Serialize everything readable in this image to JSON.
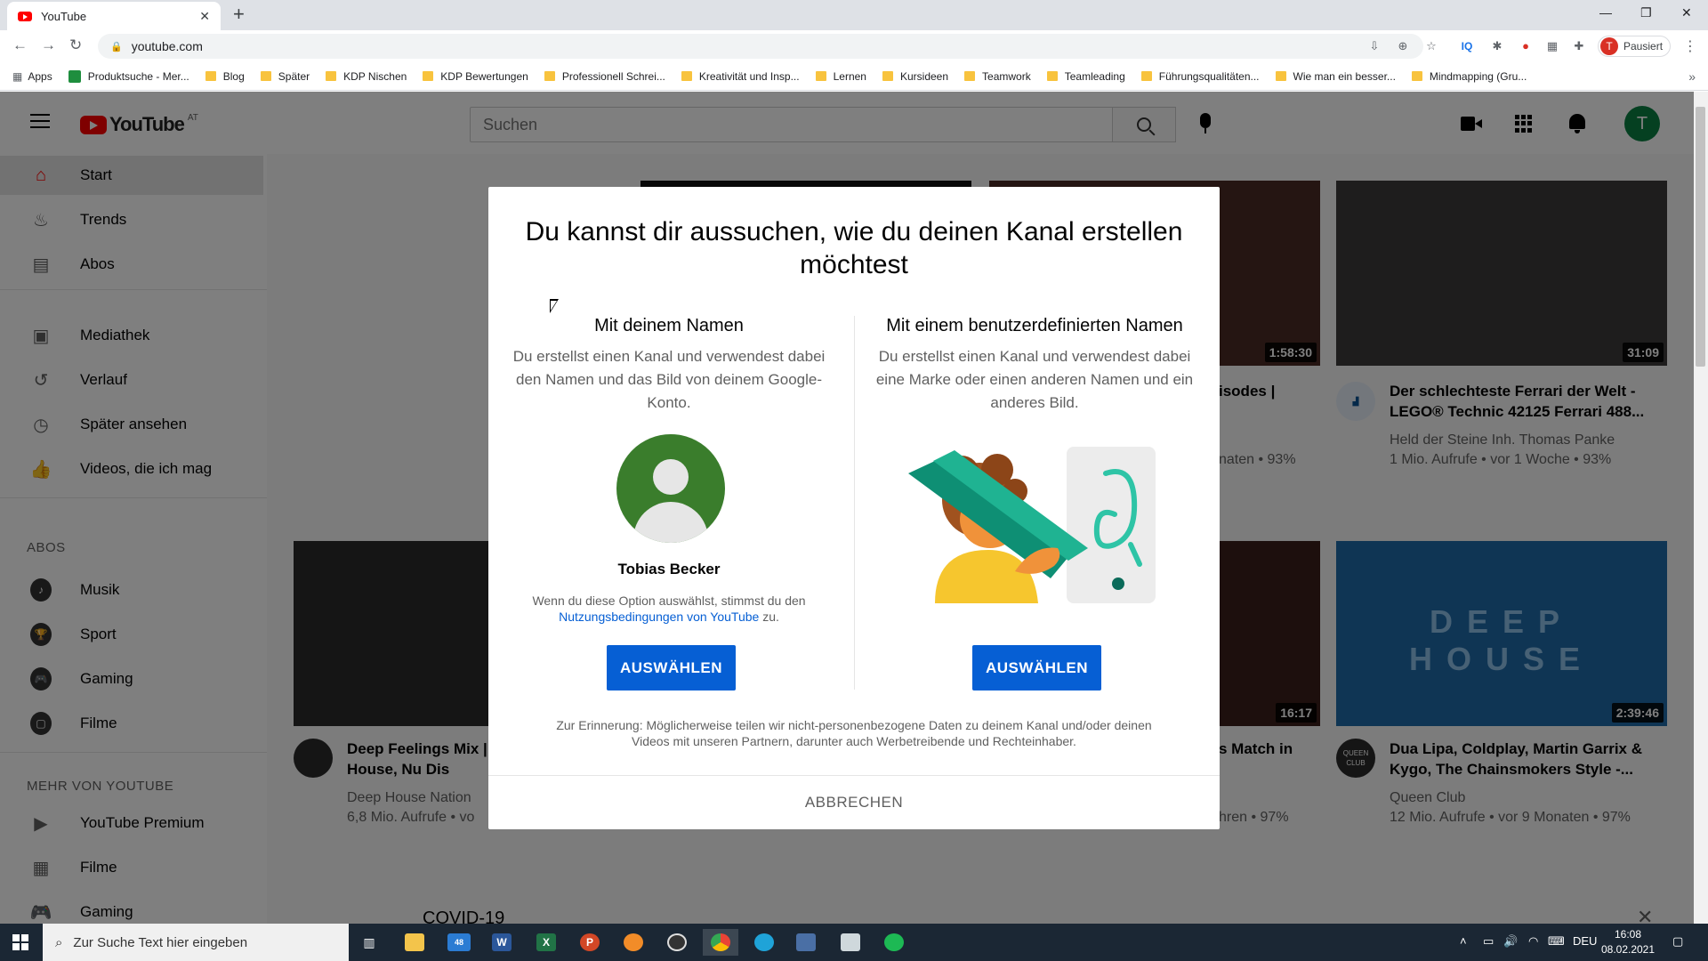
{
  "browser": {
    "tab_title": "YouTube",
    "tab_close": "✕",
    "new_tab": "+",
    "url": "youtube.com",
    "profile_initial": "T",
    "profile_status": "Pausiert",
    "bookmarks": [
      "Apps",
      "Produktsuche - Mer...",
      "Blog",
      "Später",
      "KDP Nischen",
      "KDP Bewertungen",
      "Professionell Schrei...",
      "Kreativität und Insp...",
      "Lernen",
      "Kursideen",
      "Teamwork",
      "Teamleading",
      "Führungsqualitäten...",
      "Wie man ein besser...",
      "Mindmapping (Gru..."
    ]
  },
  "youtube": {
    "logo_text": "YouTube",
    "region": "AT",
    "search_placeholder": "Suchen",
    "avatar_initial": "T",
    "sidebar": {
      "main": [
        "Start",
        "Trends",
        "Abos"
      ],
      "library": [
        "Mediathek",
        "Verlauf",
        "Später ansehen",
        "Videos, die ich mag"
      ],
      "subs_heading": "ABOS",
      "subs": [
        "Musik",
        "Sport",
        "Gaming",
        "Filme"
      ],
      "more_heading": "MEHR VON YOUTUBE",
      "more": [
        "YouTube Premium",
        "Filme",
        "Gaming"
      ]
    },
    "videos": [
      {
        "duration": "1:58:30",
        "title": "isodes |",
        "meta": "naten • 93%"
      },
      {
        "duration": "31:09",
        "title": "Der schlechteste Ferrari der Welt - LEGO® Technic 42125 Ferrari 488...",
        "channel": "Held der Steine Inh. Thomas Panke",
        "meta": "1 Mio. Aufrufe • vor 1 Woche • 93%"
      },
      {
        "title": "Deep Feelings Mix | Vocal House, Nu Dis",
        "channel": "Deep House Nation",
        "meta": "6,8 Mio. Aufrufe • vo"
      },
      {
        "duration": "16:17",
        "title": "s Match in",
        "meta": "hren • 97%"
      },
      {
        "duration": "2:39:46",
        "title": "Dua Lipa, Coldplay, Martin Garrix & Kygo, The Chainsmokers Style -...",
        "channel": "Queen Club",
        "meta": "12 Mio. Aufrufe • vor 9 Monaten • 97%",
        "thumb_text": "DEEP HOUSE",
        "avatar_text": "QUEEN CLUB"
      }
    ],
    "covid": "COVID-19",
    "covid_close": "✕"
  },
  "dialog": {
    "title": "Du kannst dir aussuchen, wie du deinen Kanal erstellen möchtest",
    "left_heading": "Mit deinem Namen",
    "left_desc": "Du erstellst einen Kanal und verwendest dabei den Namen und das Bild von deinem Google-Konto.",
    "right_heading": "Mit einem benutzerdefinierten Namen",
    "right_desc": "Du erstellst einen Kanal und verwendest dabei eine Marke oder einen anderen Namen und ein anderes Bild.",
    "user_name": "Tobias Becker",
    "terms_prefix": "Wenn du diese Option auswählst, stimmst du den",
    "terms_link": "Nutzungsbedingungen von YouTube",
    "terms_suffix": " zu.",
    "select_label": "AUSWÄHLEN",
    "reminder": "Zur Erinnerung: Möglicherweise teilen wir nicht-personenbezogene Daten zu deinem Kanal und/oder deinen Videos mit unseren Partnern, darunter auch Werbetreibende und Rechteinhaber.",
    "cancel_label": "ABBRECHEN"
  },
  "taskbar": {
    "search_placeholder": "Zur Suche Text hier eingeben",
    "mail_badge": "48",
    "lang": "DEU",
    "time": "16:08",
    "date": "08.02.2021"
  },
  "colors": {
    "yt_red": "#ff0000",
    "primary_blue": "#065fd4",
    "avatar_green": "#3a7d2c"
  }
}
